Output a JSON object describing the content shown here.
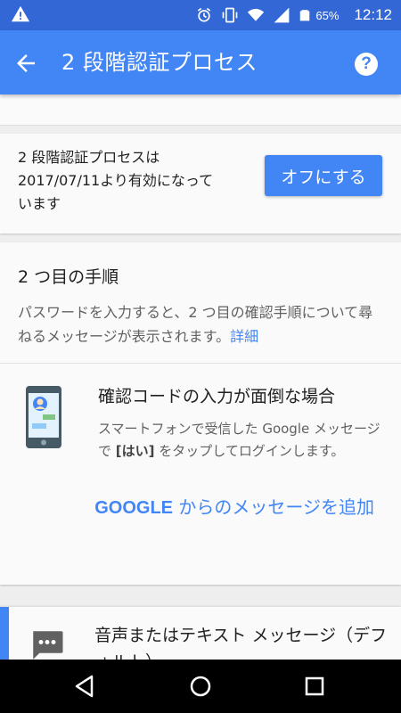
{
  "status_bar": {
    "battery_percent": "65%",
    "time": "12:12",
    "icons": [
      "warning-icon",
      "alarm-icon",
      "vibrate-icon",
      "wifi-icon",
      "signal-icon",
      "battery-icon"
    ]
  },
  "app_bar": {
    "title": "2 段階認証プロセス",
    "back_icon": "arrow-back-icon",
    "help_label": "?"
  },
  "status_card": {
    "text_line1": "2 段階認証プロセスは",
    "text_line2": "2017/07/11より有効になって",
    "text_line3": "います",
    "off_button": "オフにする"
  },
  "second_step": {
    "title": "2 つ目の手順",
    "description": "パスワードを入力すると、2 つ目の確認手順について尋ねるメッセージが表示されます。",
    "details_link": "詳細",
    "prompt_option": {
      "icon": "phone-prompt-icon",
      "title": "確認コードの入力が面倒な場合",
      "desc_part1": "スマートフォンで受信した Google メッセージで ",
      "desc_bold": "[はい]",
      "desc_part2": " をタップしてログインします。",
      "add_link_latin": "GOOGLE",
      "add_link_rest": " からのメッセージを追加"
    },
    "voice_option": {
      "icon": "message-icon",
      "title": "音声またはテキスト メッセージ（デフォルト）"
    }
  },
  "nav_bar": {
    "icons": [
      "nav-back-icon",
      "nav-home-icon",
      "nav-recents-icon"
    ]
  },
  "colors": {
    "status_bar": "#3367d6",
    "app_bar": "#4285f4",
    "accent": "#4285f4",
    "background": "#eeeeee",
    "card": "#fafafa"
  }
}
